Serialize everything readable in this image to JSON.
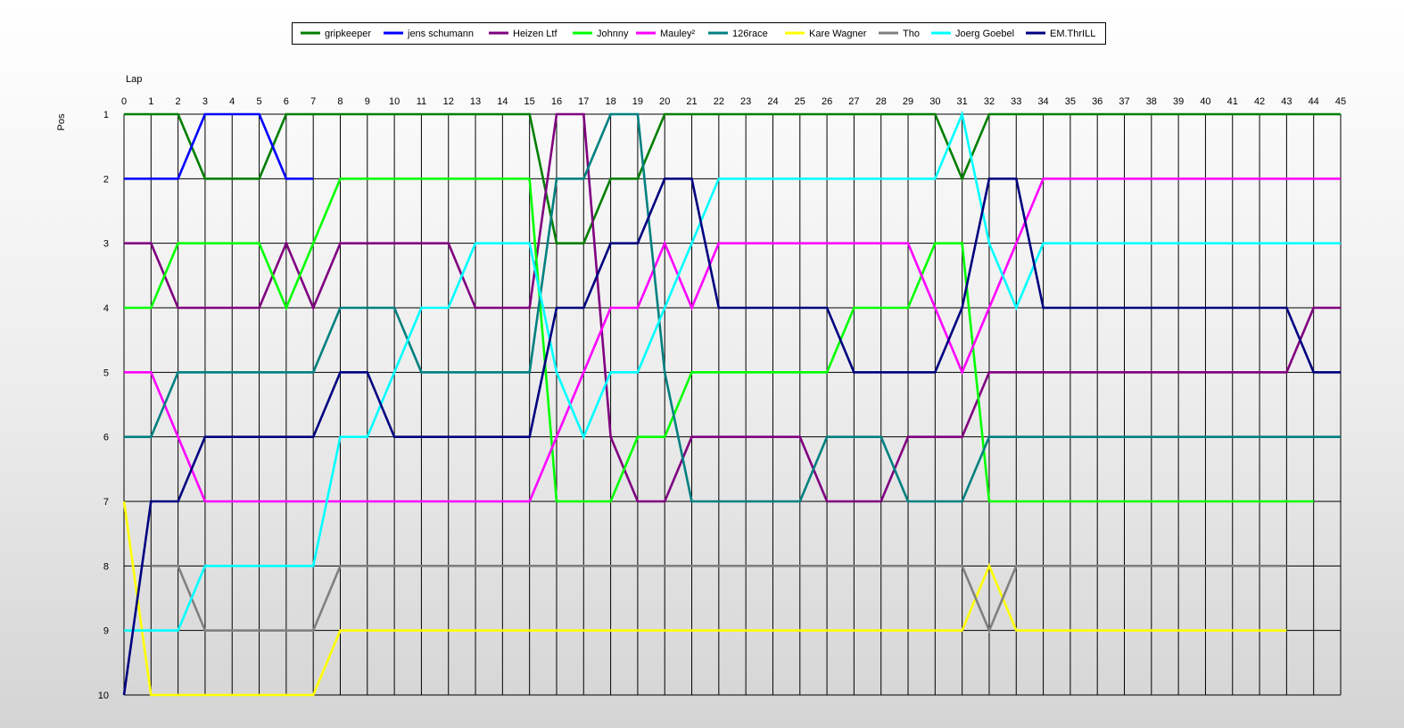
{
  "chart_data": {
    "type": "line",
    "xlabel": "Lap",
    "ylabel": "Pos",
    "xlim": [
      0,
      45
    ],
    "ylim": [
      1,
      10
    ],
    "y_inverted": true,
    "grid": true,
    "legend_position": "top-center",
    "x_ticks": [
      0,
      1,
      2,
      3,
      4,
      5,
      6,
      7,
      8,
      9,
      10,
      11,
      12,
      13,
      14,
      15,
      16,
      17,
      18,
      19,
      20,
      21,
      22,
      23,
      24,
      25,
      26,
      27,
      28,
      29,
      30,
      31,
      32,
      33,
      34,
      35,
      36,
      37,
      38,
      39,
      40,
      41,
      42,
      43,
      44,
      45
    ],
    "y_ticks": [
      1,
      2,
      3,
      4,
      5,
      6,
      7,
      8,
      9,
      10
    ],
    "series": [
      {
        "name": "gripkeeper",
        "color": "#007f00",
        "x": [
          0,
          1,
          2,
          3,
          4,
          5,
          6,
          7,
          8,
          9,
          10,
          11,
          12,
          13,
          14,
          15,
          16,
          17,
          18,
          19,
          20,
          21,
          22,
          23,
          24,
          25,
          26,
          27,
          28,
          29,
          30,
          31,
          32,
          33,
          34,
          35,
          36,
          37,
          38,
          39,
          40,
          41,
          42,
          43,
          44,
          45
        ],
        "y": [
          1,
          1,
          1,
          2,
          2,
          2,
          1,
          1,
          1,
          1,
          1,
          1,
          1,
          1,
          1,
          1,
          3,
          3,
          2,
          2,
          1,
          1,
          1,
          1,
          1,
          1,
          1,
          1,
          1,
          1,
          1,
          2,
          1,
          1,
          1,
          1,
          1,
          1,
          1,
          1,
          1,
          1,
          1,
          1,
          1,
          1
        ]
      },
      {
        "name": "jens  schumann",
        "color": "#0000ff",
        "x": [
          0,
          1,
          2,
          3,
          4,
          5,
          6,
          7
        ],
        "y": [
          2,
          2,
          2,
          1,
          1,
          1,
          2,
          2
        ]
      },
      {
        "name": "Heizen Ltf",
        "color": "#800080",
        "x": [
          0,
          1,
          2,
          3,
          4,
          5,
          6,
          7,
          8,
          9,
          10,
          11,
          12,
          13,
          14,
          15,
          16,
          17,
          18,
          19,
          20,
          21,
          22,
          23,
          24,
          25,
          26,
          27,
          28,
          29,
          30,
          31,
          32,
          33,
          34,
          35,
          36,
          37,
          38,
          39,
          40,
          41,
          42,
          43,
          44,
          45
        ],
        "y": [
          3,
          3,
          4,
          4,
          4,
          4,
          3,
          4,
          3,
          3,
          3,
          3,
          3,
          4,
          4,
          4,
          1,
          1,
          6,
          7,
          7,
          6,
          6,
          6,
          6,
          6,
          7,
          7,
          7,
          6,
          6,
          6,
          5,
          5,
          5,
          5,
          5,
          5,
          5,
          5,
          5,
          5,
          5,
          5,
          4,
          4
        ]
      },
      {
        "name": "Johnny",
        "color": "#00ff00",
        "x": [
          0,
          1,
          2,
          3,
          4,
          5,
          6,
          7,
          8,
          9,
          10,
          11,
          12,
          13,
          14,
          15,
          16,
          17,
          18,
          19,
          20,
          21,
          22,
          23,
          24,
          25,
          26,
          27,
          28,
          29,
          30,
          31,
          32,
          33,
          34,
          35,
          36,
          37,
          38,
          39,
          40,
          41,
          42,
          43,
          44
        ],
        "y": [
          4,
          4,
          3,
          3,
          3,
          3,
          4,
          3,
          2,
          2,
          2,
          2,
          2,
          2,
          2,
          2,
          7,
          7,
          7,
          6,
          6,
          5,
          5,
          5,
          5,
          5,
          5,
          4,
          4,
          4,
          3,
          3,
          7,
          7,
          7,
          7,
          7,
          7,
          7,
          7,
          7,
          7,
          7,
          7,
          7
        ]
      },
      {
        "name": "Mauley²",
        "color": "#ff00ff",
        "x": [
          0,
          1,
          2,
          3,
          4,
          5,
          6,
          7,
          8,
          9,
          10,
          11,
          12,
          13,
          14,
          15,
          16,
          17,
          18,
          19,
          20,
          21,
          22,
          23,
          24,
          25,
          26,
          27,
          28,
          29,
          30,
          31,
          32,
          33,
          34,
          35,
          36,
          37,
          38,
          39,
          40,
          41,
          42,
          43,
          44,
          45
        ],
        "y": [
          5,
          5,
          6,
          7,
          7,
          7,
          7,
          7,
          7,
          7,
          7,
          7,
          7,
          7,
          7,
          7,
          6,
          5,
          4,
          4,
          3,
          4,
          3,
          3,
          3,
          3,
          3,
          3,
          3,
          3,
          4,
          5,
          4,
          3,
          2,
          2,
          2,
          2,
          2,
          2,
          2,
          2,
          2,
          2,
          2,
          2
        ]
      },
      {
        "name": "126race",
        "color": "#008080",
        "x": [
          0,
          1,
          2,
          3,
          4,
          5,
          6,
          7,
          8,
          9,
          10,
          11,
          12,
          13,
          14,
          15,
          16,
          17,
          18,
          19,
          20,
          21,
          22,
          23,
          24,
          25,
          26,
          27,
          28,
          29,
          30,
          31,
          32,
          33,
          34,
          35,
          36,
          37,
          38,
          39,
          40,
          41,
          42,
          43,
          44,
          45
        ],
        "y": [
          6,
          6,
          5,
          5,
          5,
          5,
          5,
          5,
          4,
          4,
          4,
          5,
          5,
          5,
          5,
          5,
          2,
          2,
          1,
          1,
          5,
          7,
          7,
          7,
          7,
          7,
          6,
          6,
          6,
          7,
          7,
          7,
          6,
          6,
          6,
          6,
          6,
          6,
          6,
          6,
          6,
          6,
          6,
          6,
          6,
          6
        ]
      },
      {
        "name": "Kare Wagner",
        "color": "#ffff00",
        "x": [
          0,
          1,
          2,
          3,
          4,
          5,
          6,
          7,
          8,
          9,
          10,
          11,
          12,
          13,
          14,
          15,
          16,
          17,
          18,
          19,
          20,
          21,
          22,
          23,
          24,
          25,
          26,
          27,
          28,
          29,
          30,
          31,
          32,
          33,
          34,
          35,
          36,
          37,
          38,
          39,
          40,
          41,
          42,
          43
        ],
        "y": [
          7,
          10,
          10,
          10,
          10,
          10,
          10,
          10,
          9,
          9,
          9,
          9,
          9,
          9,
          9,
          9,
          9,
          9,
          9,
          9,
          9,
          9,
          9,
          9,
          9,
          9,
          9,
          9,
          9,
          9,
          9,
          9,
          8,
          9,
          9,
          9,
          9,
          9,
          9,
          9,
          9,
          9,
          9,
          9
        ]
      },
      {
        "name": "Tho",
        "color": "#808080",
        "x": [
          1,
          2,
          3,
          4,
          5,
          6,
          7,
          8,
          9,
          10,
          11,
          12,
          13,
          14,
          15,
          16,
          17,
          18,
          19,
          20,
          21,
          22,
          23,
          24,
          25,
          26,
          27,
          28,
          29,
          30,
          31,
          32,
          33,
          34,
          35,
          36,
          37,
          38,
          39,
          40,
          41,
          42,
          43
        ],
        "y": [
          8,
          8,
          9,
          9,
          9,
          9,
          9,
          8,
          8,
          8,
          8,
          8,
          8,
          8,
          8,
          8,
          8,
          8,
          8,
          8,
          8,
          8,
          8,
          8,
          8,
          8,
          8,
          8,
          8,
          8,
          8,
          9,
          8,
          8,
          8,
          8,
          8,
          8,
          8,
          8,
          8,
          8,
          8
        ]
      },
      {
        "name": "Joerg Goebel",
        "color": "#00ffff",
        "x": [
          0,
          1,
          2,
          3,
          4,
          5,
          6,
          7,
          8,
          9,
          10,
          11,
          12,
          13,
          14,
          15,
          16,
          17,
          18,
          19,
          20,
          21,
          22,
          23,
          24,
          25,
          26,
          27,
          28,
          29,
          30,
          31,
          32,
          33,
          34,
          35,
          36,
          37,
          38,
          39,
          40,
          41,
          42,
          43,
          44,
          45
        ],
        "y": [
          9,
          9,
          9,
          8,
          8,
          8,
          8,
          8,
          6,
          6,
          5,
          4,
          4,
          3,
          3,
          3,
          5,
          6,
          5,
          5,
          4,
          3,
          2,
          2,
          2,
          2,
          2,
          2,
          2,
          2,
          2,
          1,
          3,
          4,
          3,
          3,
          3,
          3,
          3,
          3,
          3,
          3,
          3,
          3,
          3,
          3
        ]
      },
      {
        "name": "EM.ThrILL",
        "color": "#000080",
        "x": [
          0,
          1,
          2,
          3,
          4,
          5,
          6,
          7,
          8,
          9,
          10,
          11,
          12,
          13,
          14,
          15,
          16,
          17,
          18,
          19,
          20,
          21,
          22,
          23,
          24,
          25,
          26,
          27,
          28,
          29,
          30,
          31,
          32,
          33,
          34,
          35,
          36,
          37,
          38,
          39,
          40,
          41,
          42,
          43,
          44,
          45
        ],
        "y": [
          10,
          7,
          7,
          6,
          6,
          6,
          6,
          6,
          5,
          5,
          6,
          6,
          6,
          6,
          6,
          6,
          4,
          4,
          3,
          3,
          2,
          2,
          4,
          4,
          4,
          4,
          4,
          5,
          5,
          5,
          5,
          4,
          2,
          2,
          4,
          4,
          4,
          4,
          4,
          4,
          4,
          4,
          4,
          4,
          5,
          5
        ]
      }
    ]
  }
}
